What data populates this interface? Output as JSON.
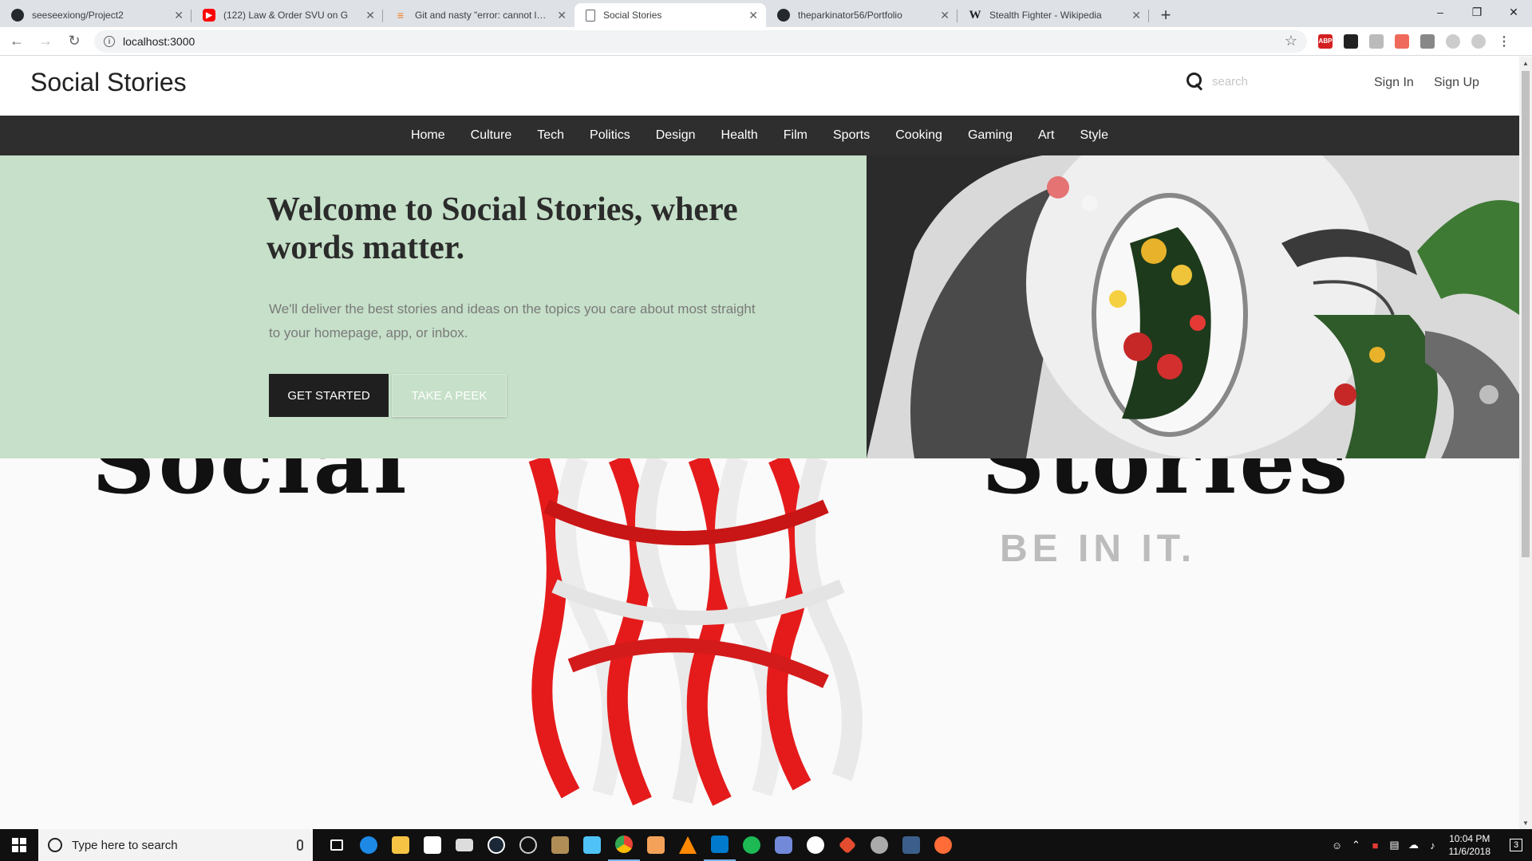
{
  "browser": {
    "tabs": [
      {
        "title": "seeseexiong/Project2",
        "icon": "github-icon",
        "fav": "gh",
        "active": false
      },
      {
        "title": "(122) Law & Order SVU on G",
        "icon": "youtube-icon",
        "fav": "yt",
        "active": false
      },
      {
        "title": "Git and nasty \"error: cannot lock",
        "icon": "stackoverflow-icon",
        "fav": "so",
        "active": false
      },
      {
        "title": "Social Stories",
        "icon": "page-icon",
        "fav": "doc",
        "active": true
      },
      {
        "title": "theparkinator56/Portfolio",
        "icon": "github-icon",
        "fav": "gh",
        "active": false
      },
      {
        "title": "Stealth Fighter - Wikipedia",
        "icon": "wikipedia-icon",
        "fav": "w",
        "active": false
      }
    ],
    "new_tab": "+",
    "url": "localhost:3000"
  },
  "site": {
    "brand": "Social Stories",
    "search_placeholder": "search",
    "sign_in": "Sign In",
    "sign_up": "Sign Up",
    "nav": [
      "Home",
      "Culture",
      "Tech",
      "Politics",
      "Design",
      "Health",
      "Film",
      "Sports",
      "Cooking",
      "Gaming",
      "Art",
      "Style"
    ]
  },
  "hero": {
    "title": "Welcome to Social Stories, where words matter.",
    "subtitle": "We'll deliver the best stories and ideas on the topics you care about most straight to your homepage, app, or inbox.",
    "cta_primary": "GET STARTED",
    "cta_secondary": "TAKE A PEEK"
  },
  "banner": {
    "left_word": "Social",
    "right_word": "Stories",
    "tagline": "BE IN IT."
  },
  "taskbar": {
    "search_placeholder": "Type here to search",
    "time": "10:04 PM",
    "date": "11/6/2018",
    "notifications": "3"
  },
  "colors": {
    "hero_bg": "#c6e0c9",
    "nav_bg": "#2e2e2e",
    "cta_dark": "#1f1f1f"
  }
}
